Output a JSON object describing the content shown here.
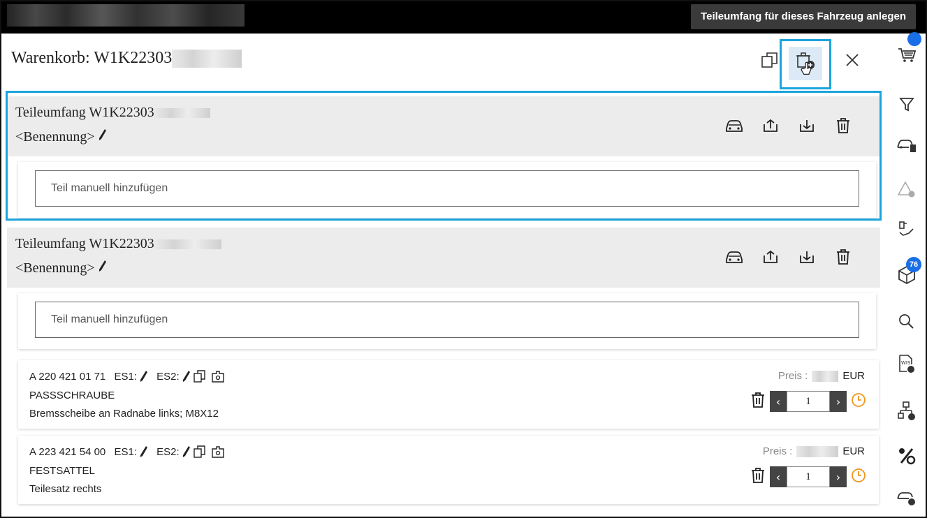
{
  "tooltip": "Teileumfang für dieses Fahrzeug anlegen",
  "cart": {
    "title_prefix": "Warenkorb: W1K22303"
  },
  "sections": [
    {
      "title_prefix": "Teileumfang W1K22303",
      "name": "<Benennung>",
      "input_placeholder": "Teil manuell hinzufügen"
    },
    {
      "title_prefix": "Teileumfang W1K22303",
      "name": "<Benennung>",
      "input_placeholder": "Teil manuell hinzufügen"
    }
  ],
  "parts": [
    {
      "number": "A 220 421 01 71",
      "es1_label": "ES1:",
      "es2_label": "ES2:",
      "name": "PASSSCHRAUBE",
      "description": "Bremsscheibe an Radnabe links; M8X12",
      "price_label": "Preis :",
      "currency": "EUR",
      "quantity": "1"
    },
    {
      "number": "A 223 421 54 00",
      "es1_label": "ES1:",
      "es2_label": "ES2:",
      "name": "FESTSATTEL",
      "description": "Teilesatz rechts",
      "price_label": "Preis :",
      "currency": "EUR",
      "quantity": "1"
    }
  ],
  "sidebar": {
    "items": [
      "cart-icon",
      "filter-icon",
      "vehicle-data-icon",
      "warning-icon",
      "oil-service-icon",
      "parts-box-icon",
      "search-icon",
      "wis-icon",
      "structure-icon",
      "discount-icon",
      "vehicle-settings-icon"
    ],
    "parts_badge": "76"
  },
  "colors": {
    "highlight": "#1ba3dc",
    "badge": "#1a6ee6",
    "clock": "#f0961e"
  }
}
